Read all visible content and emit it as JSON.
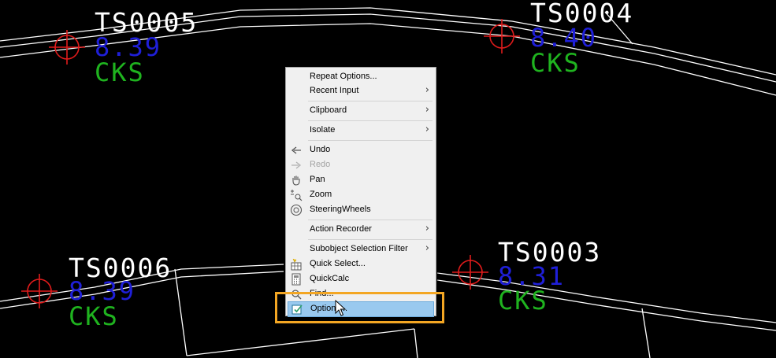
{
  "drawing": {
    "points": [
      {
        "id": "ts0005",
        "name": "TS0005",
        "elevation": "8.39",
        "code": "CKS"
      },
      {
        "id": "ts0004",
        "name": "TS0004",
        "elevation": "8.40",
        "code": "CKS"
      },
      {
        "id": "ts0006",
        "name": "TS0006",
        "elevation": "8.39",
        "code": "CKS"
      },
      {
        "id": "ts0003",
        "name": "TS0003",
        "elevation": "8.31",
        "code": "CKS"
      }
    ],
    "colors": {
      "background": "#000000",
      "linework": "#ffffff",
      "point_name": "#ffffff",
      "elevation": "#1f1fd8",
      "code": "#1fb31f",
      "marker": "#e01b1b"
    }
  },
  "context_menu": {
    "items": [
      {
        "key": "repeat_options",
        "label": "Repeat Options..."
      },
      {
        "key": "recent_input",
        "label": "Recent Input",
        "submenu": true
      },
      {
        "key": "clipboard",
        "label": "Clipboard",
        "submenu": true
      },
      {
        "key": "isolate",
        "label": "Isolate",
        "submenu": true
      },
      {
        "key": "undo",
        "label": "Undo",
        "icon": "undo-icon"
      },
      {
        "key": "redo",
        "label": "Redo",
        "icon": "redo-icon",
        "disabled": true
      },
      {
        "key": "pan",
        "label": "Pan",
        "icon": "pan-hand-icon"
      },
      {
        "key": "zoom",
        "label": "Zoom",
        "icon": "zoom-icon"
      },
      {
        "key": "steeringwheels",
        "label": "SteeringWheels",
        "icon": "steeringwheel-icon"
      },
      {
        "key": "action_recorder",
        "label": "Action Recorder",
        "submenu": true
      },
      {
        "key": "subobject_filter",
        "label": "Subobject Selection Filter",
        "submenu": true
      },
      {
        "key": "quick_select",
        "label": "Quick Select...",
        "icon": "quick-select-icon"
      },
      {
        "key": "quickcalc",
        "label": "QuickCalc",
        "icon": "calculator-icon"
      },
      {
        "key": "find",
        "label": "Find...",
        "icon": "find-icon"
      },
      {
        "key": "options",
        "label": "Options...",
        "icon": "options-icon",
        "highlighted": true
      }
    ],
    "submenu_arrow": "›"
  },
  "annotation": {
    "callout_color": "#f3a623"
  }
}
